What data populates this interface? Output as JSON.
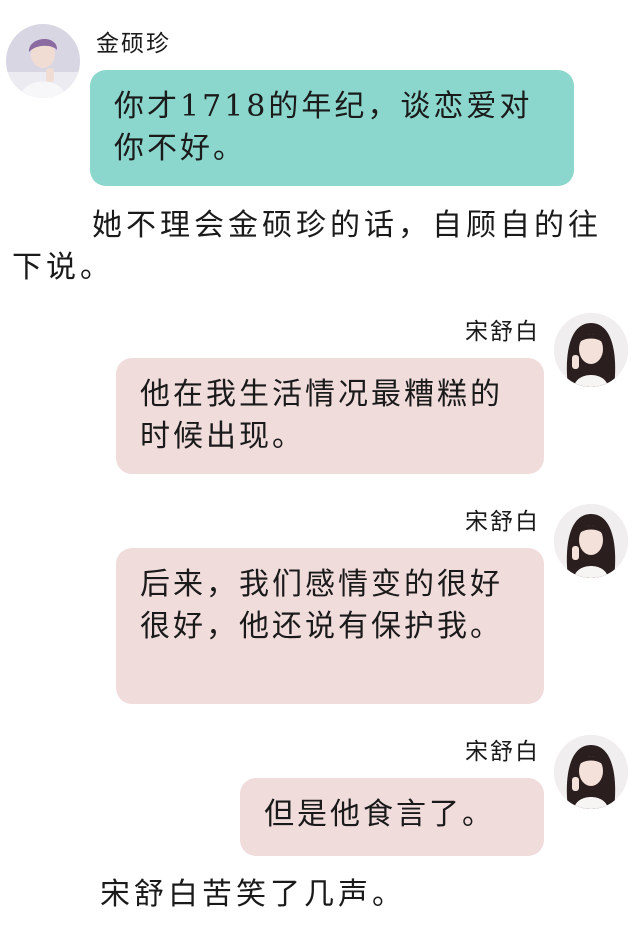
{
  "conversation": [
    {
      "type": "message",
      "speaker": "金硕珍",
      "side": "left",
      "avatar_icon": "avatar-man-icon",
      "text": "你才1718的年纪，谈恋爱对你不好。"
    },
    {
      "type": "narration",
      "text": "她不理会金硕珍的话，自顾自的往下说。"
    },
    {
      "type": "message",
      "speaker": "宋舒白",
      "side": "right",
      "avatar_icon": "avatar-woman-icon",
      "text": "他在我生活情况最糟糕的时候出现。"
    },
    {
      "type": "message",
      "speaker": "宋舒白",
      "side": "right",
      "avatar_icon": "avatar-woman-icon",
      "text": "后来，我们感情变的很好很好，他还说有保护我。"
    },
    {
      "type": "message",
      "speaker": "宋舒白",
      "side": "right",
      "avatar_icon": "avatar-woman-icon",
      "text": "但是他食言了。"
    },
    {
      "type": "narration",
      "text": "宋舒白苦笑了几声。"
    }
  ],
  "colors": {
    "left_bubble": "#8cd7cd",
    "right_bubble": "#f1dcdc",
    "background": "#ffffff"
  }
}
